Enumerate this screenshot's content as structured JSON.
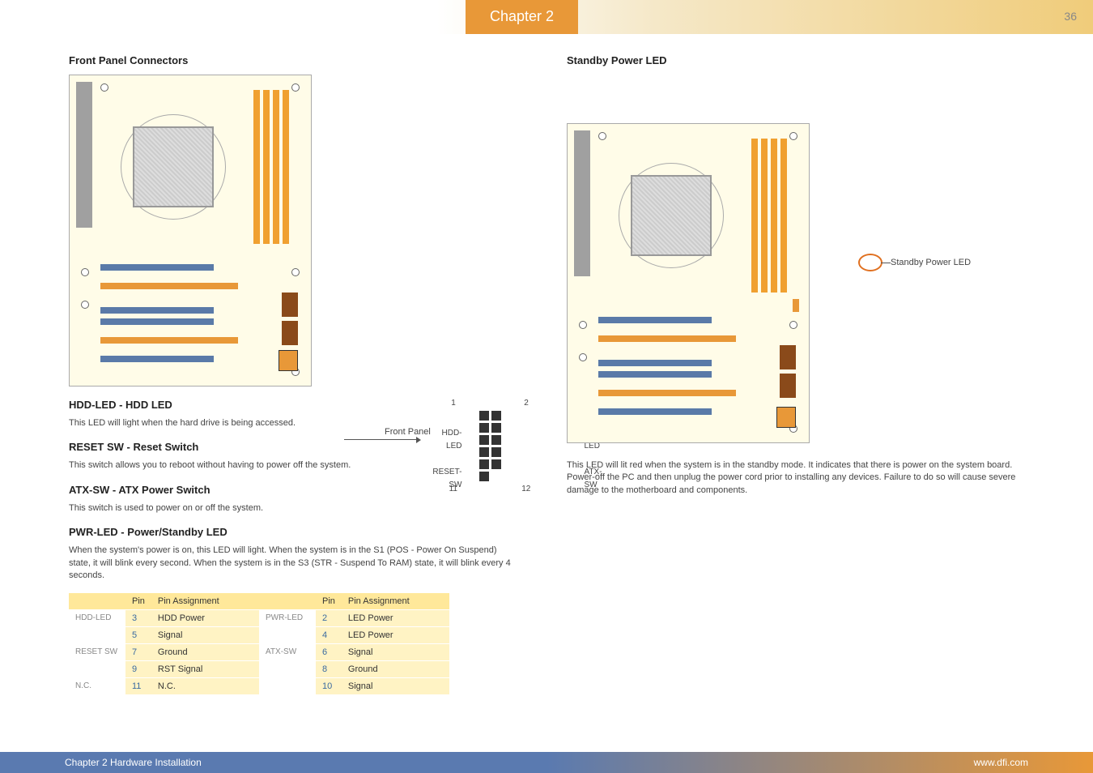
{
  "header": {
    "chapter_tab": "Chapter 2",
    "page_number": "36"
  },
  "left": {
    "section_title": "Front Panel Connectors",
    "diagram_callout": {
      "front_panel": "Front Panel",
      "hdd_led": "HDD-LED",
      "reset_sw": "RESET-SW",
      "pwr_led": "PWR-LED",
      "atx_sw": "ATX-SW",
      "pin1": "1",
      "pin2": "2",
      "pin11": "11",
      "pin12": "12"
    },
    "hdd_led_title": "HDD-LED - HDD LED",
    "hdd_led_text": "This LED will light when the hard drive is being accessed.",
    "reset_title": "RESET SW - Reset Switch",
    "reset_text": "This switch allows you to reboot without having to power off the system.",
    "atx_title": "ATX-SW - ATX Power Switch",
    "atx_text": "This switch is used to power on or off the system.",
    "pwr_led_title": "PWR-LED - Power/Standby LED",
    "pwr_led_text": "When the system's power is on, this LED will light. When the system is in the S1 (POS - Power On Suspend) state, it will blink every second. When the system is in the S3 (STR - Suspend To RAM) state, it will blink every 4 seconds.",
    "table": {
      "headers": [
        "",
        "Pin",
        "Pin Assignment",
        "",
        "Pin",
        "Pin Assignment"
      ],
      "rows": [
        [
          "HDD-LED",
          "3",
          "HDD Power",
          "PWR-LED",
          "2",
          "LED Power"
        ],
        [
          "",
          "5",
          "Signal",
          "",
          "4",
          "LED Power"
        ],
        [
          "RESET SW",
          "7",
          "Ground",
          "ATX-SW",
          "6",
          "Signal"
        ],
        [
          "",
          "9",
          "RST Signal",
          "",
          "8",
          "Ground"
        ],
        [
          "N.C.",
          "11",
          "N.C.",
          "",
          "10",
          "Signal"
        ]
      ]
    }
  },
  "right": {
    "section_title": "Standby Power LED",
    "standby_label": "Standby Power LED",
    "standby_text": "This LED will lit red when the system is in the standby mode. It indicates that there is power on the system board. Power-off the PC and then unplug the power cord prior to installing any devices. Failure to do so will cause severe damage to the motherboard and components."
  },
  "footer": {
    "left": "Chapter 2 Hardware Installation",
    "right": "www.dfi.com"
  }
}
